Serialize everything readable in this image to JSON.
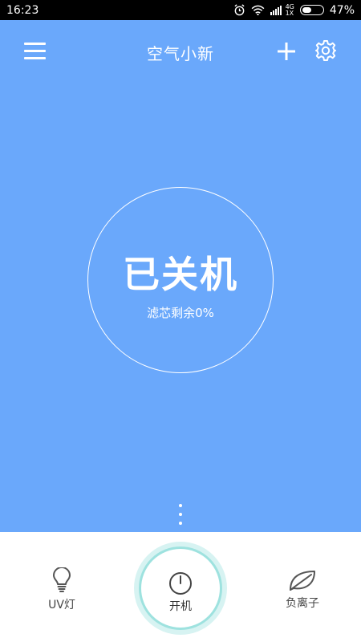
{
  "status_bar": {
    "time": "16:23",
    "network": [
      "4G",
      "1X"
    ],
    "battery": "47%",
    "icons": [
      "alarm-icon",
      "wifi-icon",
      "signal-icon",
      "battery-icon"
    ]
  },
  "header": {
    "title": "空气小新",
    "icons": [
      "menu-icon",
      "plus-icon",
      "gear-icon"
    ]
  },
  "status": {
    "power_state": "已关机",
    "filter_text": "滤芯剩余0%"
  },
  "controls": {
    "uv_label": "UV灯",
    "power_label": "开机",
    "ion_label": "负离子",
    "icons": [
      "bulb-icon",
      "power-icon",
      "leaf-icon"
    ]
  },
  "colors": {
    "background": "#6aa8fb",
    "accent_ring": "#9ee2df",
    "panel": "#ffffff"
  }
}
